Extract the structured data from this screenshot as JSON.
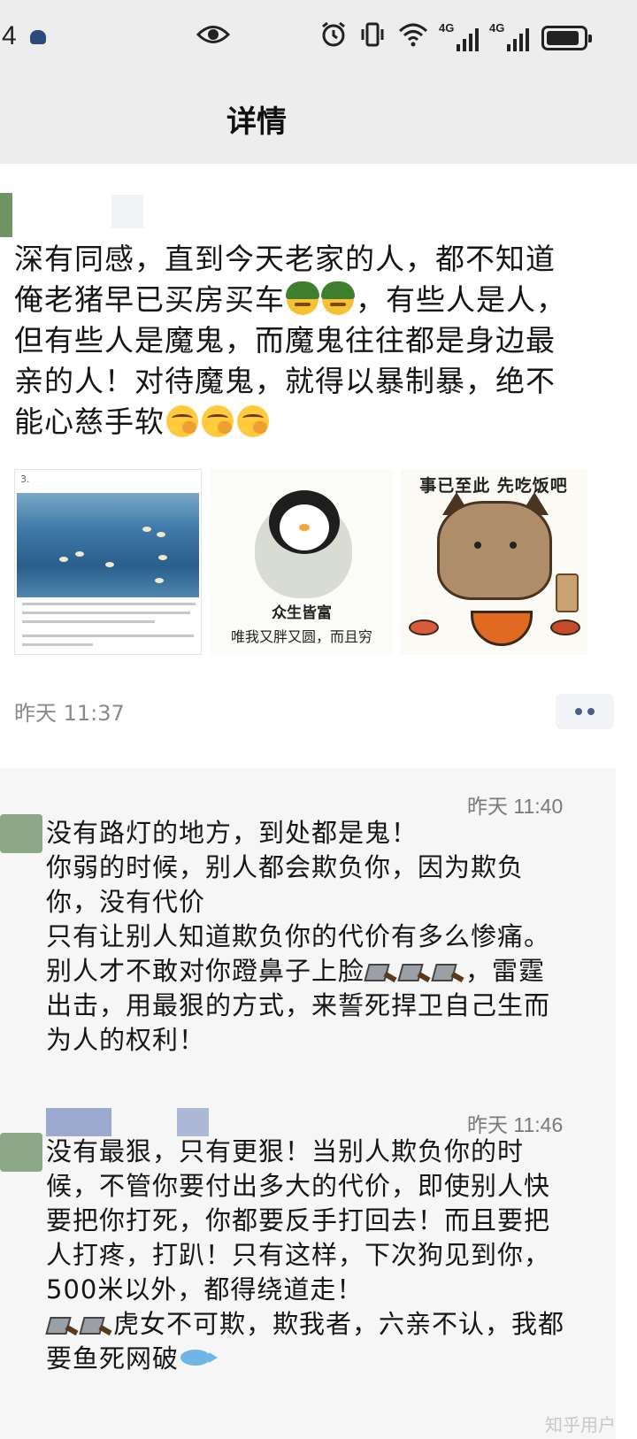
{
  "status_bar": {
    "clock": "4",
    "signal_1": "4G",
    "signal_2": "4G",
    "icons": [
      "eye-icon",
      "alarm-icon",
      "vibrate-icon",
      "wifi-icon",
      "signal-4g-icon",
      "signal-4g-icon",
      "battery-icon"
    ]
  },
  "header": {
    "title": "详情"
  },
  "post": {
    "text_lines": [
      "深有同感，直到今天老家的人，都不知道",
      "俺老猪早已买房买车",
      "，有些人是人，",
      "但有些人是魔鬼，而魔鬼往往都是身边最",
      "亲的人！对待魔鬼，就得以暴制暴，绝不",
      "能心慈手软"
    ],
    "images": [
      {
        "label_num": "3."
      },
      {
        "caption_1": "众生皆富",
        "caption_2": "唯我又胖又圆，而且穷"
      },
      {
        "caption": "事已至此 先吃饭吧"
      }
    ],
    "time": "昨天 11:37"
  },
  "comments": [
    {
      "time": "昨天 11:40",
      "lines": [
        "没有路灯的地方，到处都是鬼！",
        "你弱的时候，别人都会欺负你，因为欺负",
        "你，没有代价",
        "只有让别人知道欺负你的代价有多么惨痛。",
        "别人才不敢对你蹬鼻子上脸",
        "，雷霆",
        "出击，用最狠的方式，来誓死捍卫自己生而",
        "为人的权利！"
      ]
    },
    {
      "time": "昨天 11:46",
      "lines": [
        "没有最狠，只有更狠！当别人欺负你的时",
        "候，不管你要付出多大的代价，即使别人快",
        "要把你打死，你都要反手打回去！而且要把",
        "人打疼，打趴！只有这样，下次狗见到你，",
        "500米以外，都得绕道走！",
        "虎女不可欺，欺我者，六亲不认，我都",
        "要鱼死网破"
      ]
    }
  ],
  "watermark": "知乎用户"
}
